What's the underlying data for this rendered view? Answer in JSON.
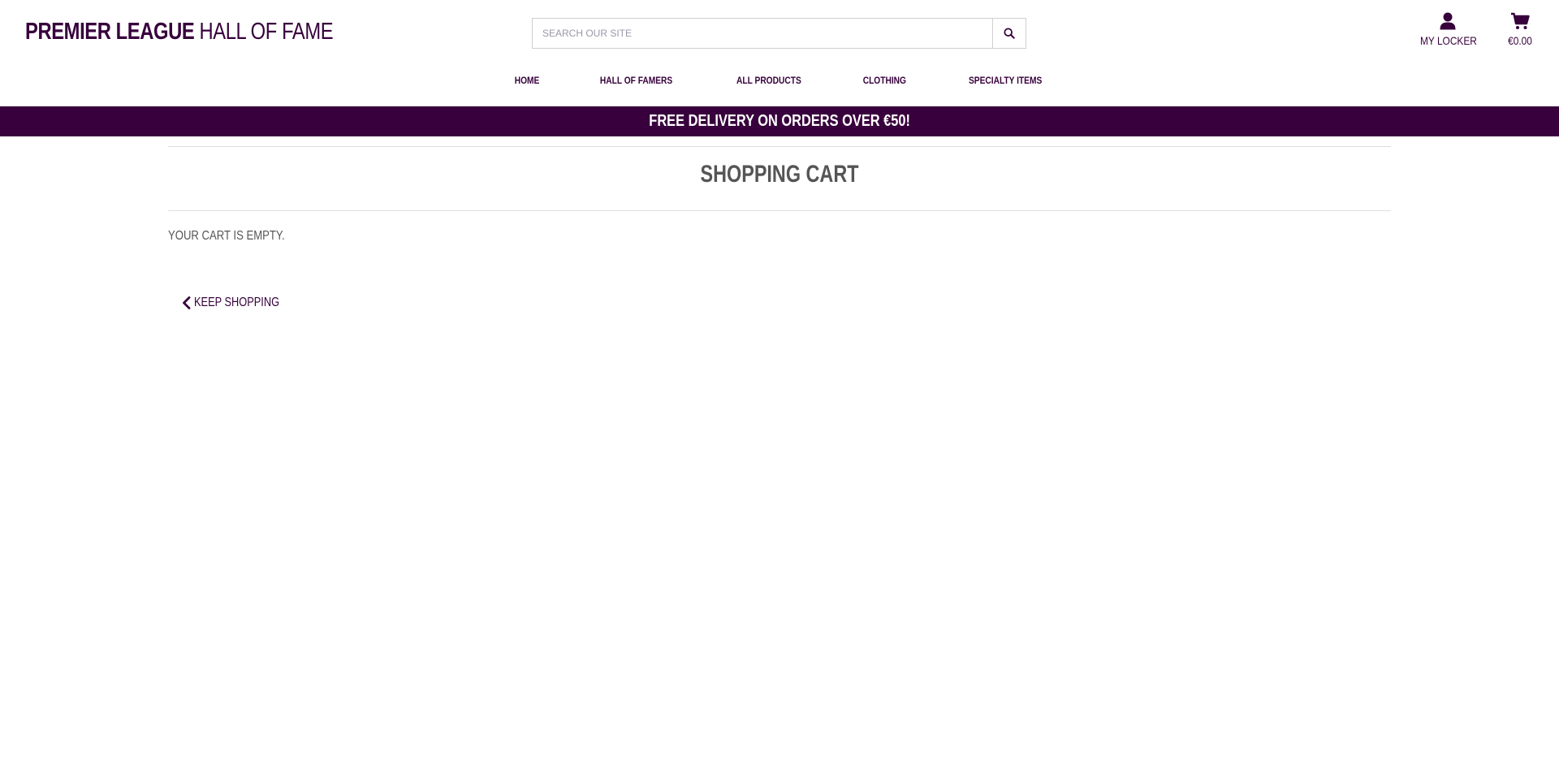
{
  "brand": {
    "bold": "Premier League",
    "light": "Hall of Fame"
  },
  "search": {
    "placeholder": "Search our site",
    "button_icon": "search-icon"
  },
  "account": {
    "label": "My Locker",
    "icon": "user-icon"
  },
  "cart": {
    "total": "€0.00",
    "icon": "cart-icon"
  },
  "nav": {
    "items": [
      {
        "label": "Home"
      },
      {
        "label": "Hall of Famers"
      },
      {
        "label": "All Products"
      },
      {
        "label": "Clothing"
      },
      {
        "label": "Specialty Items"
      }
    ]
  },
  "banner": {
    "text": "Free delivery on orders over €50!"
  },
  "page": {
    "title": "Shopping Cart",
    "empty_message": "Your cart is empty.",
    "keep_shopping": "Keep Shopping"
  },
  "colors": {
    "brand": "#37003c",
    "banner_bg": "#38003c",
    "text_muted": "#555555"
  }
}
